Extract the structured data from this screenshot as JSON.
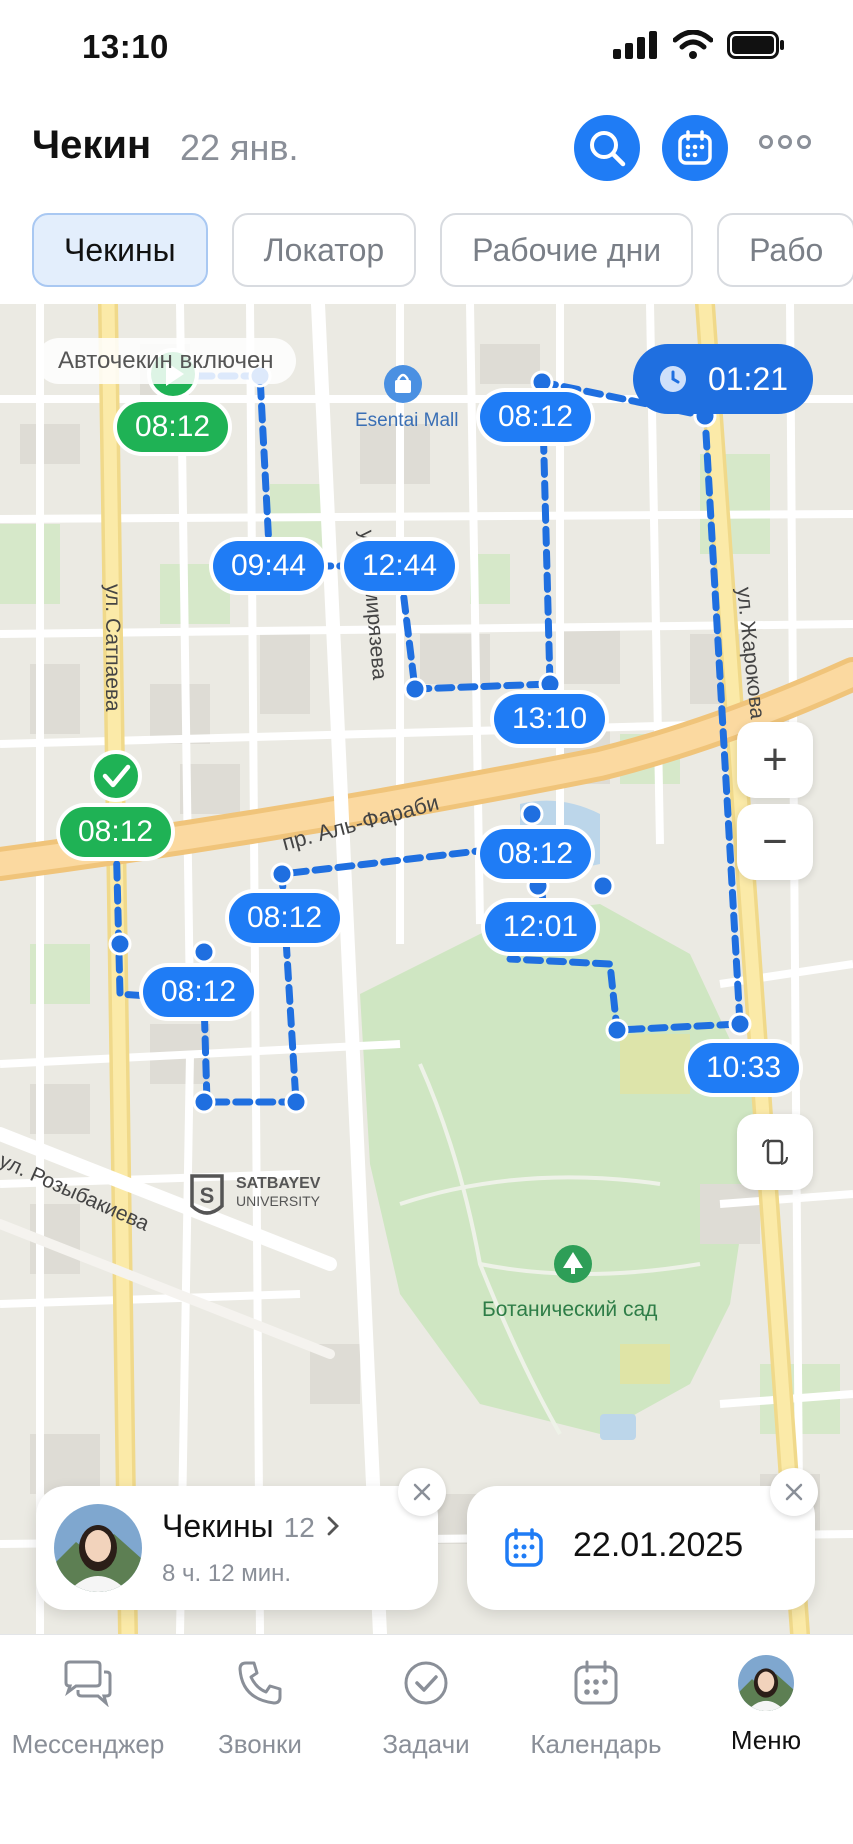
{
  "status_bar": {
    "time": "13:10"
  },
  "header": {
    "title": "Чекин",
    "date": "22 янв.",
    "icons": [
      "search-icon",
      "calendar-icon",
      "more-icon"
    ]
  },
  "tabs": [
    {
      "label": "Чекины",
      "active": true
    },
    {
      "label": "Локатор",
      "active": false
    },
    {
      "label": "Рабочие дни",
      "active": false
    },
    {
      "label": "Рабо",
      "active": false
    }
  ],
  "map": {
    "autocheckin": "Авточекин включен",
    "timer": "01:21",
    "zoom_in": "+",
    "zoom_out": "−",
    "streets": {
      "satpaeva": "ул. Сатпаева",
      "timiryazeva": "ул. Тимирязева",
      "zharokova": "ул. Жарокова",
      "al_farabi": "пр. Аль-Фараби",
      "rozybakieva": "ул. Розыбакиева"
    },
    "places": {
      "mall": "Esentai Mall",
      "garden": "Ботанический сад",
      "university_1": "SATBAYEV",
      "university_2": "UNIVERSITY"
    },
    "checkpoints": [
      {
        "time": "08:12",
        "color": "green",
        "icon": "play-icon"
      },
      {
        "time": "09:44",
        "color": "blue"
      },
      {
        "time": "12:44",
        "color": "blue"
      },
      {
        "time": "08:12",
        "color": "blue"
      },
      {
        "time": "13:10",
        "color": "blue"
      },
      {
        "time": "08:12",
        "color": "green",
        "icon": "check-icon"
      },
      {
        "time": "08:12",
        "color": "blue"
      },
      {
        "time": "08:12",
        "color": "blue"
      },
      {
        "time": "12:01",
        "color": "blue"
      },
      {
        "time": "08:12",
        "color": "blue"
      },
      {
        "time": "10:33",
        "color": "blue"
      }
    ]
  },
  "summary_card": {
    "title": "Чекины",
    "count": "12",
    "duration": "8 ч. 12 мин."
  },
  "date_card": {
    "date": "22.01.2025"
  },
  "nav": [
    {
      "label": "Мессенджер",
      "icon": "chat-icon",
      "active": false
    },
    {
      "label": "Звонки",
      "icon": "phone-icon",
      "active": false
    },
    {
      "label": "Задачи",
      "icon": "check-circle-icon",
      "active": false
    },
    {
      "label": "Календарь",
      "icon": "calendar-icon",
      "active": false
    },
    {
      "label": "Меню",
      "icon": "avatar",
      "active": true
    }
  ],
  "colors": {
    "accent": "#1f7cf5",
    "green": "#1fb255",
    "route": "#1f6fe0"
  }
}
